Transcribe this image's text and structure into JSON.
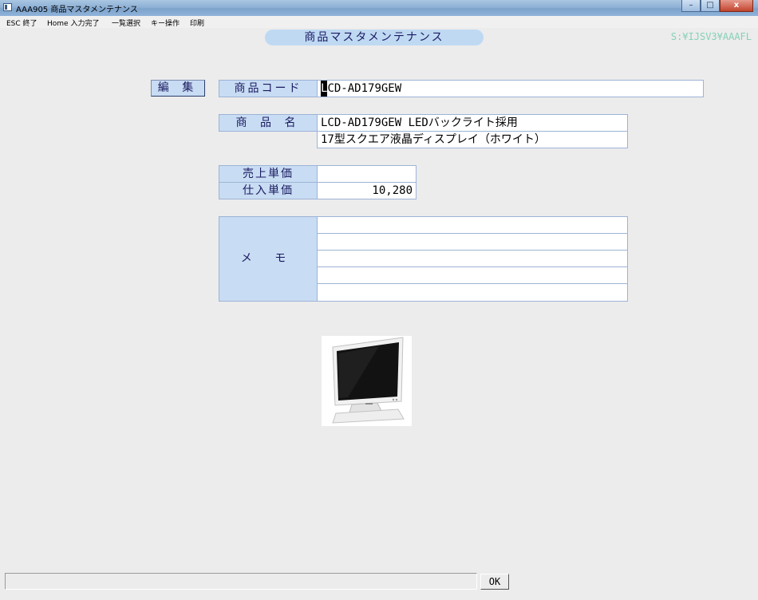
{
  "window": {
    "title": "AAA905 商品マスタメンテナンス",
    "controls": {
      "minimize": "–",
      "maximize": "□",
      "close": "x"
    }
  },
  "menu": {
    "items": [
      "ESC 終了",
      "Home 入力完了",
      "一覧選択",
      "キー操作",
      "印刷"
    ]
  },
  "header": {
    "screen_title": "商品マスタメンテナンス",
    "path": "S:¥IJSV3¥AAAFL"
  },
  "mode": {
    "label": "編 集"
  },
  "form": {
    "product_code": {
      "label": "商品コード",
      "value_first": "L",
      "value_rest": "CD-AD179GEW"
    },
    "product_name": {
      "label": "商 品 名",
      "line1": "LCD-AD179GEW LEDバックライト採用",
      "line2": "17型スクエア液晶ディスプレイ（ホワイト）"
    },
    "sales_price": {
      "label": "売上単価",
      "value": ""
    },
    "purchase_price": {
      "label": "仕入単価",
      "value": "10,280"
    },
    "memo": {
      "label": "メ モ",
      "lines": [
        "",
        "",
        "",
        "",
        ""
      ]
    }
  },
  "preview": {
    "icon": "lcd-monitor-white"
  },
  "footer": {
    "status_text": "",
    "ok_label": "OK"
  }
}
